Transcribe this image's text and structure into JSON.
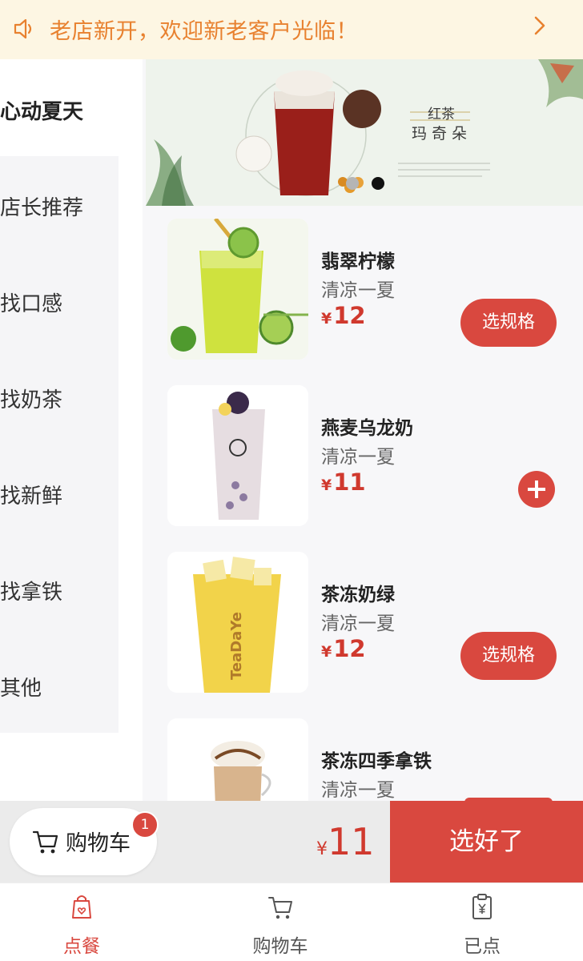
{
  "notice": {
    "text": "老店新开，欢迎新老客户光临！",
    "icon": "speaker-icon",
    "arrow_icon": "chevron-right-icon",
    "text_color": "#e8812f",
    "bg_color": "#fdf6e3"
  },
  "sidebar": {
    "active": "心动夏天",
    "items": [
      {
        "label": "店长推荐"
      },
      {
        "label": "找口感"
      },
      {
        "label": "找奶茶"
      },
      {
        "label": "找新鲜"
      },
      {
        "label": "找拿铁"
      },
      {
        "label": "其他"
      }
    ]
  },
  "banner": {
    "title": "红茶",
    "subtitle": "玛奇朵",
    "slides": 2,
    "active_slide": 2
  },
  "products": [
    {
      "name": "翡翠柠檬",
      "desc": "清凉一夏",
      "currency": "¥",
      "price": "12",
      "action": "选规格"
    },
    {
      "name": "燕麦乌龙奶",
      "desc": "清凉一夏",
      "currency": "¥",
      "price": "11",
      "action": "plus-icon"
    },
    {
      "name": "茶冻奶绿",
      "desc": "清凉一夏",
      "currency": "¥",
      "price": "12",
      "action": "选规格"
    },
    {
      "name": "茶冻四季拿铁",
      "desc": "清凉一夏",
      "currency": "¥",
      "price": "",
      "action": ""
    }
  ],
  "cart": {
    "label": "购物车",
    "badge": "1",
    "currency": "¥",
    "total": "11",
    "checkout_label": "选好了"
  },
  "tabs": [
    {
      "label": "点餐",
      "icon": "bag-heart-icon",
      "active": true
    },
    {
      "label": "购物车",
      "icon": "cart-icon",
      "active": false
    },
    {
      "label": "已点",
      "icon": "clipboard-yen-icon",
      "active": false
    }
  ],
  "colors": {
    "accent": "#d9483f",
    "price": "#d0392e",
    "active_tab": "#d9483f",
    "inactive_tab": "#555555"
  }
}
